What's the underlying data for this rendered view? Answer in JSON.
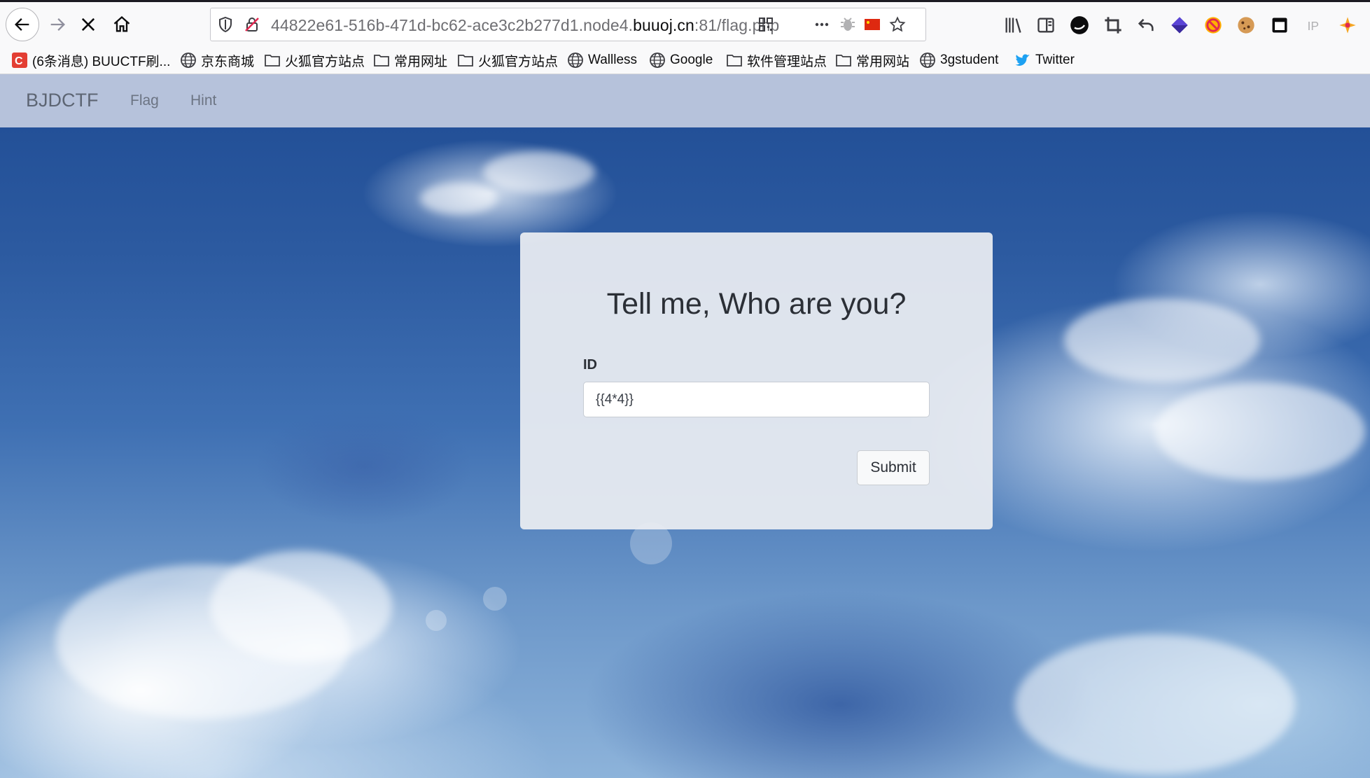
{
  "browser": {
    "url_prefix": "44822e61-516b-471d-bc62-ace3c2b277d1.node4.",
    "url_host": "buuoj.cn",
    "url_suffix": ":81/flag.php"
  },
  "bookmarks": [
    {
      "label": "(6条消息) BUUCTF刷...",
      "icon": "csdn-icon"
    },
    {
      "label": "京东商城",
      "icon": "globe-icon"
    },
    {
      "label": "火狐官方站点",
      "icon": "folder-icon"
    },
    {
      "label": "常用网址",
      "icon": "folder-icon"
    },
    {
      "label": "火狐官方站点",
      "icon": "folder-icon"
    },
    {
      "label": "Wallless",
      "icon": "globe-icon"
    },
    {
      "label": "Google",
      "icon": "globe-icon"
    },
    {
      "label": "软件管理站点",
      "icon": "folder-icon"
    },
    {
      "label": "常用网站",
      "icon": "folder-icon"
    },
    {
      "label": "3gstudent",
      "icon": "globe-icon"
    },
    {
      "label": "Twitter",
      "icon": "twitter-icon"
    }
  ],
  "navbar": {
    "brand": "BJDCTF",
    "links": [
      "Flag",
      "Hint"
    ]
  },
  "form": {
    "title": "Tell me, Who are you?",
    "id_label": "ID",
    "id_value": "{{4*4}}",
    "submit_label": "Submit"
  },
  "colors": {
    "navbar_bg": "#b6c2db",
    "card_bg": "#e9ecf1",
    "twitter_blue": "#1da1f2",
    "csdn_red": "#e33e33"
  }
}
